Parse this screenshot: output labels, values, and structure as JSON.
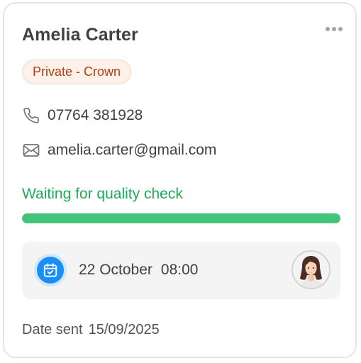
{
  "card": {
    "name": "Amelia Carter",
    "tag": "Private - Crown",
    "phone": "07764 381928",
    "email": "amelia.carter@gmail.com",
    "status": "Waiting for quality check",
    "progress_percent": 100,
    "appointment": {
      "date": "22 October",
      "time": "08:00"
    },
    "date_sent_label": "Date sent",
    "date_sent_value": "15/09/2025"
  },
  "icons": {
    "menu": "more-horizontal-icon",
    "phone": "phone-icon",
    "email": "mail-icon",
    "calendar": "calendar-check-icon"
  },
  "colors": {
    "status_green": "#1faa58",
    "progress_fill": "#42c57b",
    "tag_text": "#b43d11",
    "tag_bg": "#fdf1ea",
    "calendar_blue": "#1a8ef4"
  }
}
